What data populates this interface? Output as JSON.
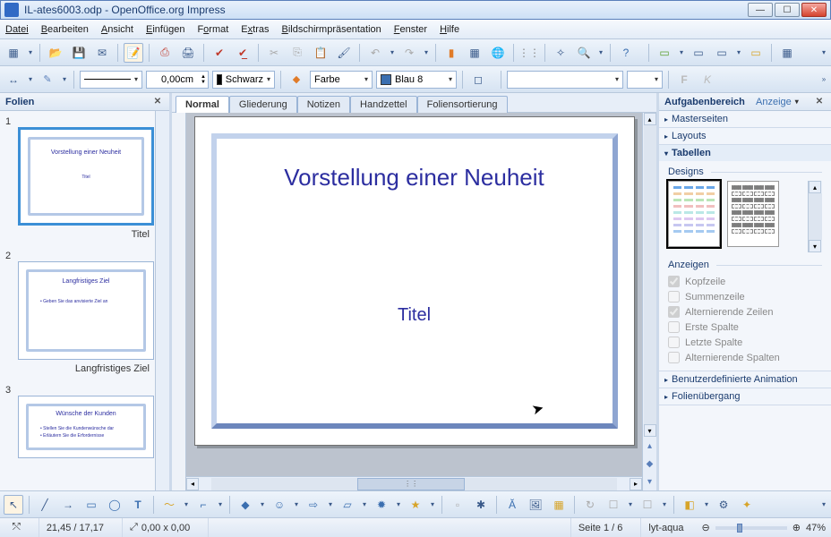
{
  "window": {
    "title": "IL-ates6003.odp - OpenOffice.org Impress"
  },
  "menu": {
    "items": [
      "Datei",
      "Bearbeiten",
      "Ansicht",
      "Einfügen",
      "Format",
      "Extras",
      "Bildschirmpräsentation",
      "Fenster",
      "Hilfe"
    ]
  },
  "toolbar2": {
    "linewidth": "0,00cm",
    "linecolor_label": "Schwarz",
    "fillmode_label": "Farbe",
    "fillcolor_label": "Blau 8"
  },
  "slides_panel": {
    "title": "Folien",
    "slides": [
      {
        "num": "1",
        "title": "Vorstellung einer Neuheit",
        "sub": "Titel",
        "label": "Titel",
        "selected": true
      },
      {
        "num": "2",
        "title": "Langfristiges Ziel",
        "body1": "• Geben Sie das anvisierte Ziel an",
        "label": "Langfristiges Ziel"
      },
      {
        "num": "3",
        "title": "Wünsche der Kunden",
        "body1": "• Stellen Sie die Kundenwünsche dar",
        "body2": "• Erläutern Sie die Erfordernisse",
        "label": ""
      }
    ]
  },
  "viewtabs": [
    "Normal",
    "Gliederung",
    "Notizen",
    "Handzettel",
    "Foliensortierung"
  ],
  "slide": {
    "title": "Vorstellung einer Neuheit",
    "subtitle": "Titel"
  },
  "tasks": {
    "title": "Aufgabenbereich",
    "view_label": "Anzeige",
    "sections": {
      "master": "Masterseiten",
      "layouts": "Layouts",
      "tables": "Tabellen",
      "anim": "Benutzerdefinierte Animation",
      "trans": "Folienübergang"
    },
    "designs_label": "Designs",
    "show_label": "Anzeigen",
    "checks": {
      "header": "Kopfzeile",
      "sumrow": "Summenzeile",
      "altrows": "Alternierende Zeilen",
      "firstcol": "Erste Spalte",
      "lastcol": "Letzte Spalte",
      "altcols": "Alternierende Spalten"
    }
  },
  "status": {
    "coords": "21,45 / 17,17",
    "size": "0,00 x 0,00",
    "page": "Seite 1 / 6",
    "layout": "lyt-aqua",
    "zoom": "47%"
  },
  "design_colors": {
    "a": [
      "#6aa7e8",
      "#e8b06a",
      "#8dd68a",
      "#e89696",
      "#8ddad6",
      "#c8a2e8",
      "#a2a2e8",
      "#6aa7e8"
    ],
    "b": [
      "#7d7d7d",
      "#7d7d7d",
      "#7d7d7d",
      "#7d7d7d",
      "#7d7d7d",
      "#7d7d7d",
      "#7d7d7d",
      "#7d7d7d"
    ]
  }
}
